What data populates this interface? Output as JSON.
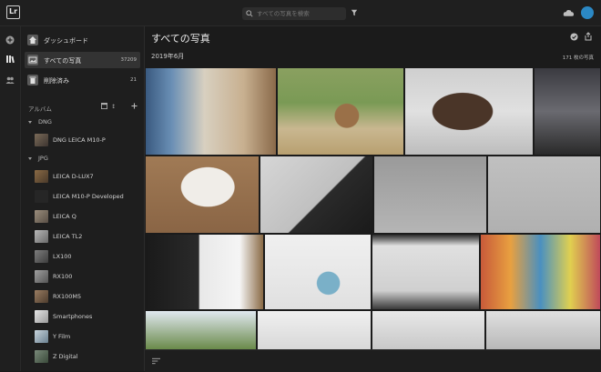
{
  "app": {
    "logo_text": "Lr"
  },
  "search": {
    "placeholder": "すべての写真を検索"
  },
  "sidebar": {
    "items": [
      {
        "label": "ダッシュボード",
        "count": ""
      },
      {
        "label": "すべての写真",
        "count": "37209"
      },
      {
        "label": "削除済み",
        "count": "21"
      }
    ],
    "albums_header": "アルバム",
    "groups": [
      {
        "label": "DNG",
        "albums": [
          "DNG LEICA M10-P"
        ]
      },
      {
        "label": "JPG",
        "albums": [
          "LEICA D-LUX7",
          "LEICA M10-P Developed",
          "LEICA Q",
          "LEICA TL2",
          "LX100",
          "RX100",
          "RX100M5",
          "Smartphones",
          "Y Film",
          "Z Digital"
        ]
      }
    ]
  },
  "main": {
    "title": "すべての写真",
    "date_label": "2019年6月",
    "count_label": "171 枚の写真"
  },
  "colors": {
    "accent": "#2b88c4",
    "selected_row": "#333333",
    "background": "#1b1b1b"
  }
}
